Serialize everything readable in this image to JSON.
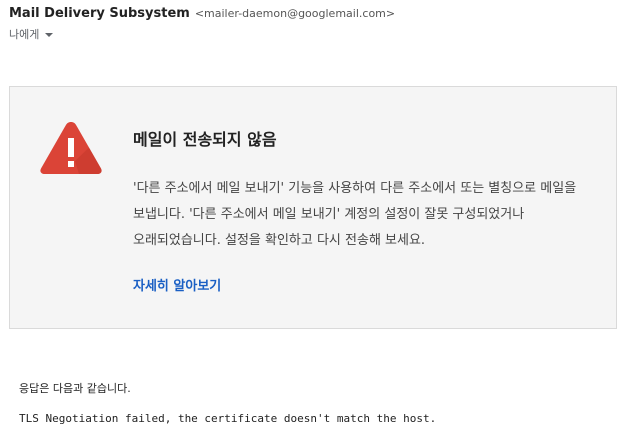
{
  "header": {
    "sender_name": "Mail Delivery Subsystem",
    "sender_email": "<mailer-daemon@googlemail.com>",
    "recipient_label": "나에게"
  },
  "card": {
    "icon": "warning-triangle-icon",
    "icon_color": "#db4437",
    "title": "메일이 전송되지 않음",
    "body": "'다른 주소에서 메일 보내기' 기능을 사용하여 다른 주소에서 또는 별칭으로 메일을 보냅니다. '다른 주소에서 메일 보내기' 계정의 설정이 잘못 구성되었거나 오래되었습니다. 설정을 확인하고 다시 전송해 보세요.",
    "learn_more": "자세히 알아보기",
    "link_color": "#1a5fc4"
  },
  "response": {
    "label": "응답은 다음과 같습니다.",
    "error": "TLS Negotiation failed, the certificate doesn't match the host."
  }
}
